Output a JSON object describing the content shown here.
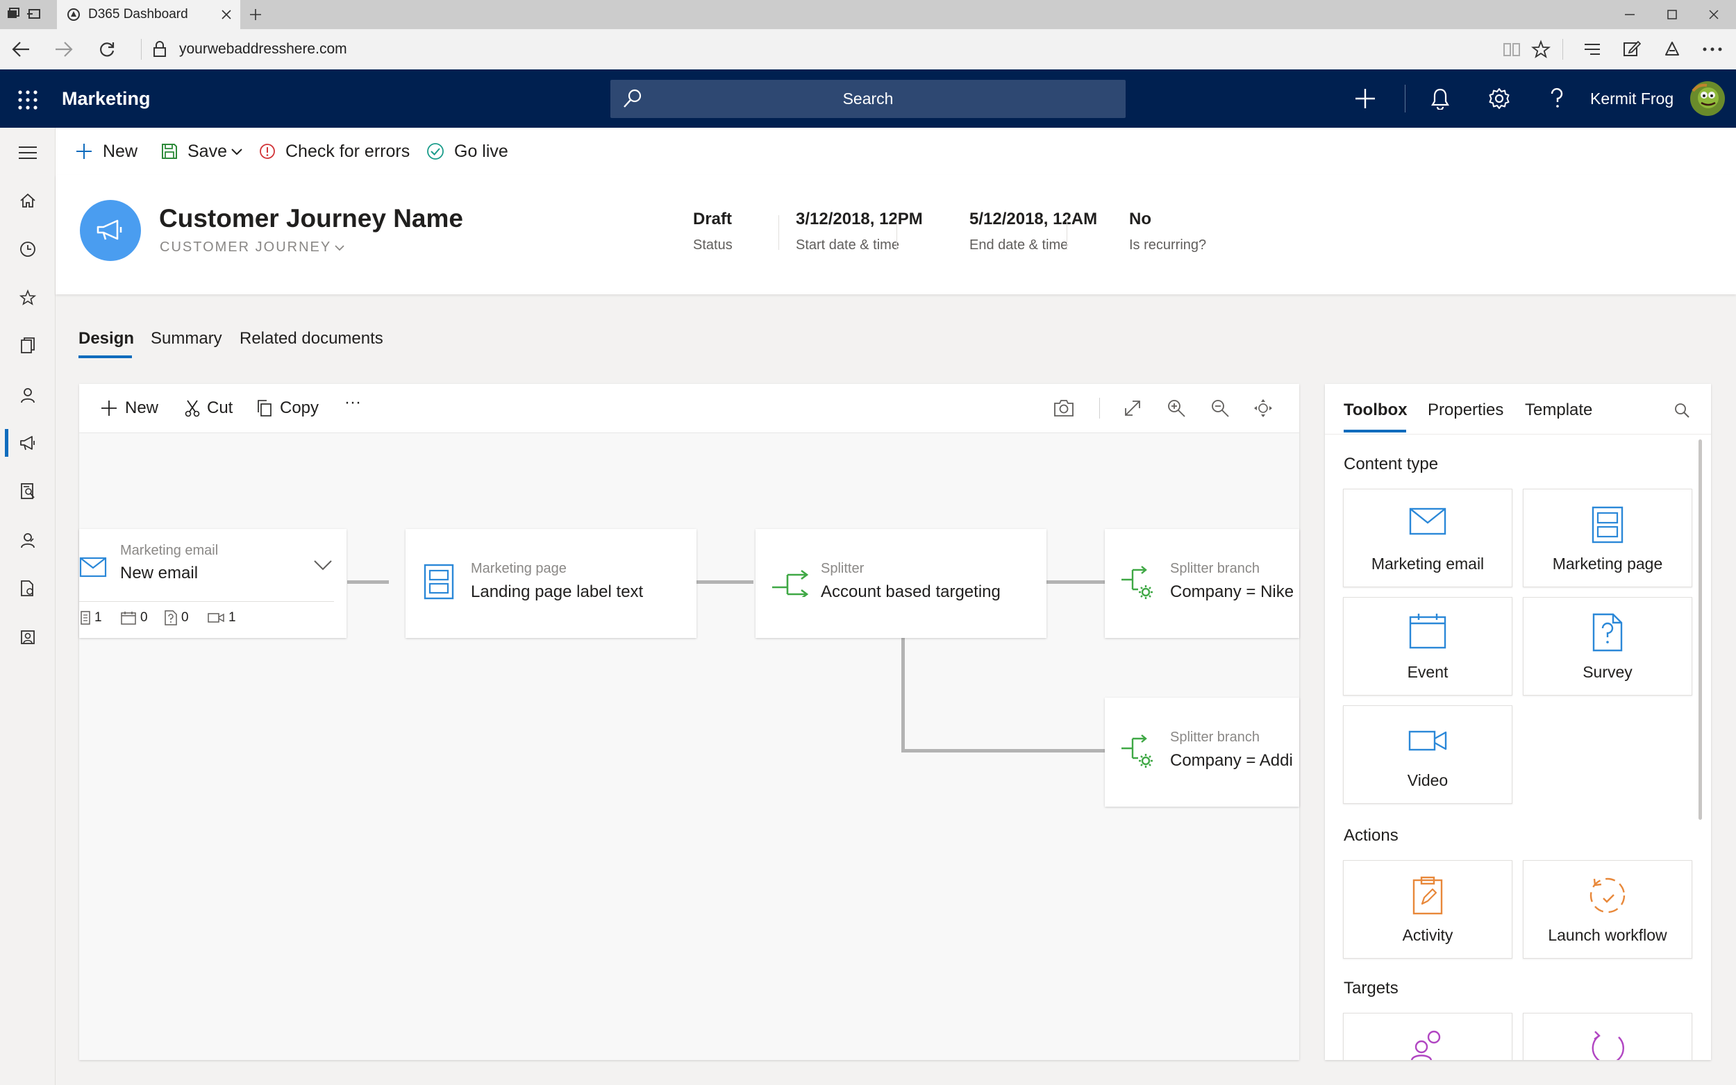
{
  "browser": {
    "tab_title": "D365 Dashboard",
    "url": "yourwebaddresshere.com"
  },
  "app": {
    "title": "Marketing",
    "search_placeholder": "Search",
    "user_name": "Kermit Frog"
  },
  "commands": {
    "new": "New",
    "save": "Save",
    "check": "Check for errors",
    "golive": "Go live"
  },
  "record": {
    "title": "Customer Journey Name",
    "entity": "CUSTOMER JOURNEY",
    "fields": {
      "status": {
        "value": "Draft",
        "label": "Status"
      },
      "start": {
        "value": "3/12/2018, 12PM",
        "label": "Start date & time"
      },
      "end": {
        "value": "5/12/2018, 12AM",
        "label": "End date & time"
      },
      "recurring": {
        "value": "No",
        "label": "Is recurring?"
      }
    }
  },
  "tabs": {
    "design": "Design",
    "summary": "Summary",
    "related": "Related documents"
  },
  "canvas": {
    "toolbar": {
      "new": "New",
      "cut": "Cut",
      "copy": "Copy",
      "more": "···"
    },
    "tiles": {
      "email": {
        "kind": "Marketing email",
        "name": "New email",
        "stats": {
          "pages": "1",
          "events": "0",
          "surveys": "0",
          "videos": "1"
        }
      },
      "page": {
        "kind": "Marketing page",
        "name": "Landing page label text"
      },
      "splitter": {
        "kind": "Splitter",
        "name": "Account based targeting"
      },
      "branch1": {
        "kind": "Splitter branch",
        "name": "Company = Nike"
      },
      "branch2": {
        "kind": "Splitter branch",
        "name": "Company = Addi"
      }
    }
  },
  "panel": {
    "tabs": {
      "toolbox": "Toolbox",
      "properties": "Properties",
      "template": "Template"
    },
    "content_type_title": "Content type",
    "content_cards": {
      "email": "Marketing email",
      "page": "Marketing page",
      "event": "Event",
      "survey": "Survey",
      "video": "Video"
    },
    "actions_title": "Actions",
    "action_cards": {
      "activity": "Activity",
      "workflow": "Launch workflow"
    },
    "targets_title": "Targets"
  },
  "colors": {
    "app_bar": "#002050",
    "accent": "#0f6cbd",
    "content_icon": "#2b88d8",
    "splitter_icon": "#3fa845",
    "action_icon": "#e8883a",
    "target_icon": "#b146c2"
  }
}
